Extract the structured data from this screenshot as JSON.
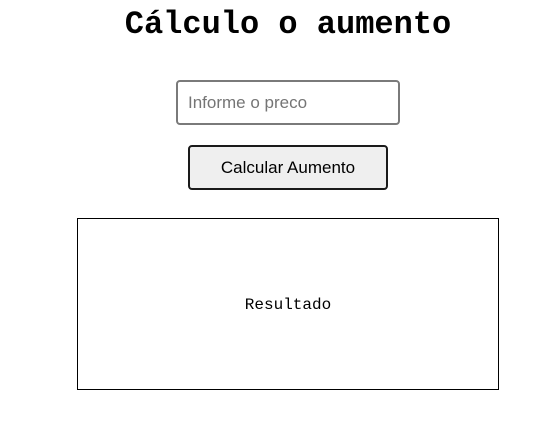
{
  "header": {
    "title": "Cálculo o aumento"
  },
  "form": {
    "price_value": "",
    "price_placeholder": "Informe o preco",
    "calculate_label": "Calcular Aumento"
  },
  "result": {
    "text": "Resultado"
  }
}
